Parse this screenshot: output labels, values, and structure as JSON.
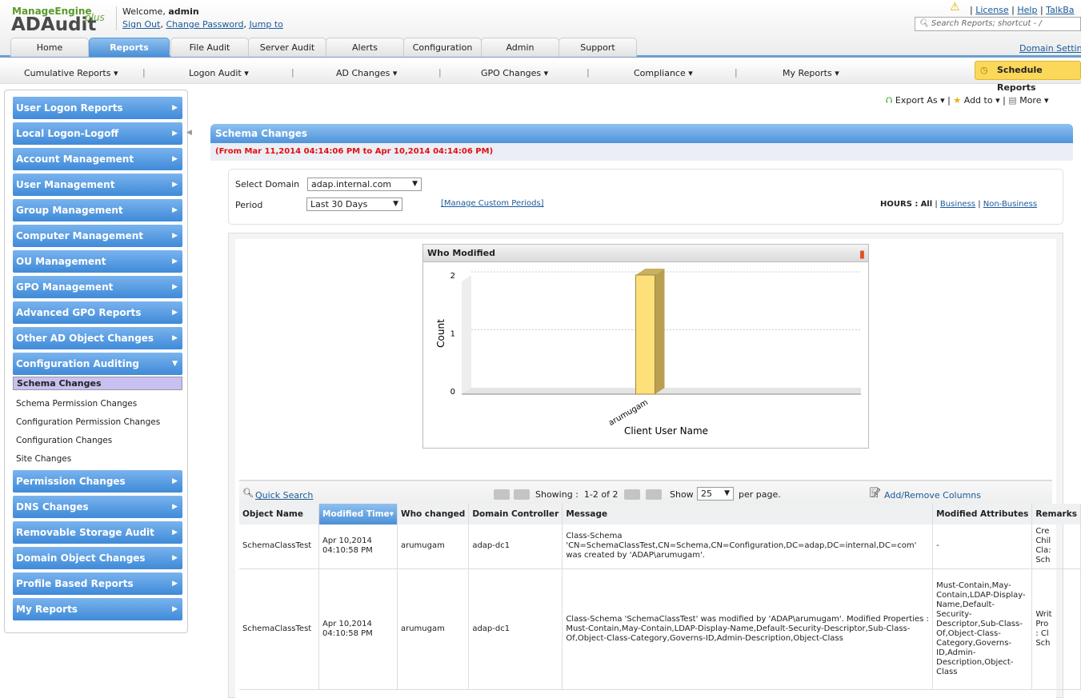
{
  "header": {
    "logo_brand": "ManageEngine",
    "logo_product": "ADAudit",
    "logo_plus": "plus",
    "welcome": "Welcome,",
    "user": "admin",
    "sign_out": "Sign Out",
    "change_password": "Change Password",
    "jump_to": "Jump to",
    "license": "License",
    "help": "Help",
    "talkback": "TalkBa",
    "search_placeholder": "Search Reports; shortcut - /",
    "domain_settings": "Domain Settin"
  },
  "tabs": [
    "Home",
    "Reports",
    "File Audit",
    "Server Audit",
    "Alerts",
    "Configuration",
    "Admin",
    "Support"
  ],
  "subnav": [
    "Cumulative Reports ▾",
    "Logon Audit ▾",
    "AD Changes ▾",
    "GPO Changes ▾",
    "Compliance ▾",
    "My Reports ▾"
  ],
  "schedule_reports": "Schedule Reports",
  "actions": {
    "export": "Export As ▾",
    "add_to": "Add to ▾",
    "more": "More ▾"
  },
  "sidebar": {
    "top": [
      "User Logon Reports",
      "Local Logon-Logoff",
      "Account Management",
      "User Management",
      "Group Management",
      "Computer Management",
      "OU Management",
      "GPO Management",
      "Advanced GPO Reports",
      "Other AD Object Changes",
      "Configuration Auditing"
    ],
    "sub": [
      "Schema Changes",
      "Schema Permission Changes",
      "Configuration Permission Changes",
      "Configuration Changes",
      "Site Changes"
    ],
    "bottom": [
      "Permission Changes",
      "DNS Changes",
      "Removable Storage Audit",
      "Domain Object Changes",
      "Profile Based Reports",
      "My Reports"
    ]
  },
  "report": {
    "title": "Schema Changes",
    "range": "(From Mar 11,2014 04:14:06 PM to Apr 10,2014 04:14:06 PM)",
    "select_domain_label": "Select Domain",
    "domain": "adap.internal.com",
    "period_label": "Period",
    "period": "Last 30 Days",
    "manage_periods": "[Manage Custom Periods]",
    "hours_label": "HOURS :",
    "hours_all": "All",
    "hours_business": "Business",
    "hours_nonbusiness": "Non-Business"
  },
  "chart_data": {
    "type": "bar",
    "title": "Who Modified",
    "categories": [
      "arumugam"
    ],
    "values": [
      2
    ],
    "xlabel": "Client User Name",
    "ylabel": "Count",
    "ylim": [
      0,
      2
    ],
    "yticks": [
      "0",
      "1",
      "2"
    ],
    "bar_color": "#fde07a"
  },
  "grid": {
    "quick_search": "Quick Search",
    "showing": "Showing :  1-2 of 2",
    "show": "Show",
    "page_size": "25",
    "per_page": "per page.",
    "add_remove": "Add/Remove Columns",
    "columns": [
      "Object Name",
      "Modified Time▾",
      "Who changed",
      "Domain Controller",
      "Message",
      "Modified Attributes",
      "Remarks"
    ],
    "rows": [
      [
        "SchemaClassTest",
        "Apr 10,2014 04:10:58 PM",
        "arumugam",
        "adap-dc1",
        "Class-Schema 'CN=SchemaClassTest,CN=Schema,CN=Configuration,DC=adap,DC=internal,DC=com' was created by 'ADAP\\arumugam'.",
        "-",
        "Cre\nChil\nCla:\nSch"
      ],
      [
        "SchemaClassTest",
        "Apr 10,2014 04:10:58 PM",
        "arumugam",
        "adap-dc1",
        "Class-Schema 'SchemaClassTest' was modified by 'ADAP\\arumugam'. Modified Properties : Must-Contain,May-Contain,LDAP-Display-Name,Default-Security-Descriptor,Sub-Class-Of,Object-Class-Category,Governs-ID,Admin-Description,Object-Class",
        "Must-Contain,May-Contain,LDAP-Display-Name,Default-Security-Descriptor,Sub-Class-Of,Object-Class-Category,Governs-ID,Admin-Description,Object-Class",
        "Writ\nPro\n: Cl\nSch"
      ]
    ]
  }
}
